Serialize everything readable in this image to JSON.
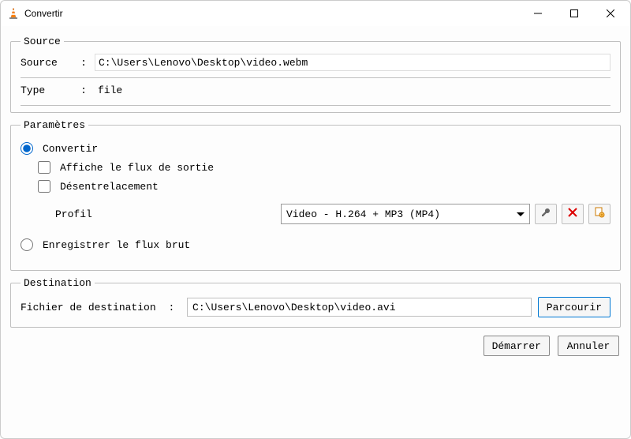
{
  "window": {
    "title": "Convertir"
  },
  "source": {
    "legend": "Source",
    "source_label": "Source",
    "source_value": "C:\\Users\\Lenovo\\Desktop\\video.webm",
    "type_label": "Type",
    "type_value": "file"
  },
  "params": {
    "legend": "Paramètres",
    "convert_label": "Convertir",
    "show_output_label": "Affiche le flux de sortie",
    "deinterlace_label": "Désentrelacement",
    "profile_label": "Profil",
    "profile_value": "Video - H.264 + MP3 (MP4)",
    "dump_raw_label": "Enregistrer le flux brut"
  },
  "destination": {
    "legend": "Destination",
    "file_label": "Fichier de destination",
    "file_value": "C:\\Users\\Lenovo\\Desktop\\video.avi",
    "browse_label": "Parcourir"
  },
  "buttons": {
    "start_label": "Démarrer",
    "cancel_label": "Annuler"
  },
  "colors": {
    "accent": "#0066cc"
  }
}
